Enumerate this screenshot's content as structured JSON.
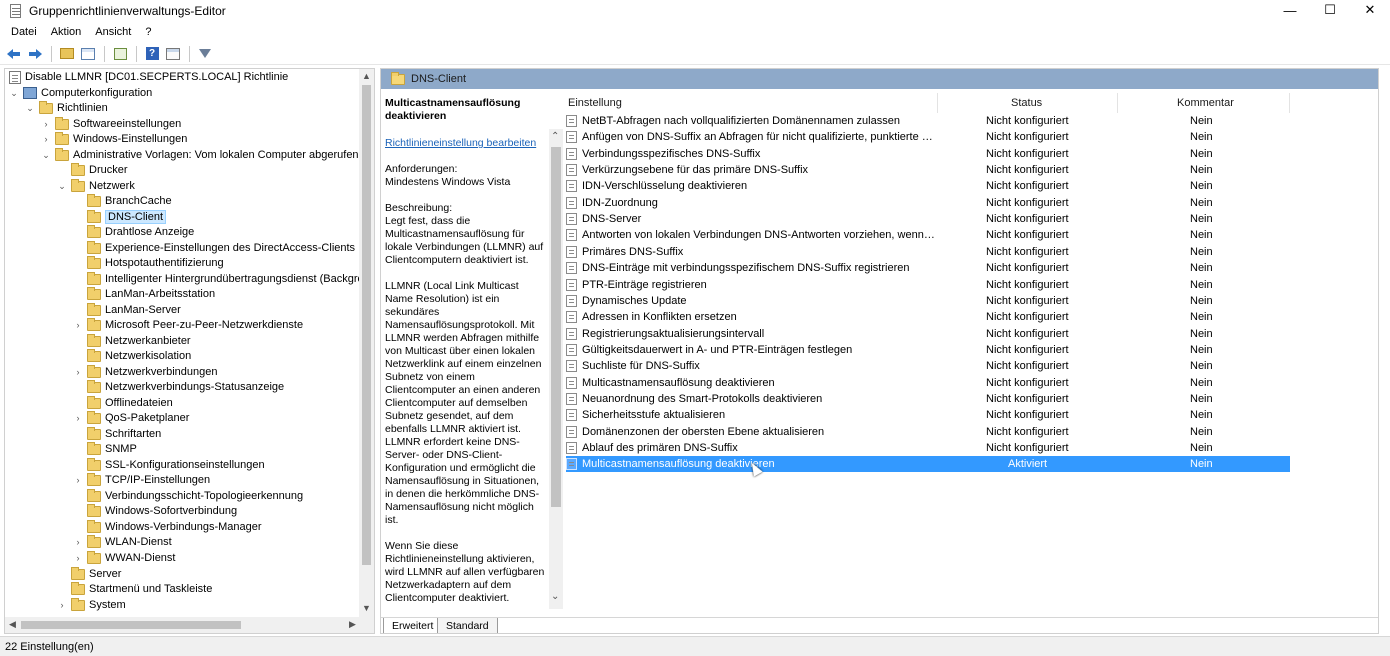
{
  "window": {
    "title": "Gruppenrichtlinienverwaltungs-Editor",
    "minimize": "—",
    "maximize": "☐",
    "close": "✕"
  },
  "menu": [
    "Datei",
    "Aktion",
    "Ansicht",
    "?"
  ],
  "tree": {
    "root": "Disable LLMNR [DC01.SECPERTS.LOCAL] Richtlinie",
    "computer": "Computerkonfiguration",
    "policies": "Richtlinien",
    "software": "Softwareeinstellungen",
    "windows": "Windows-Einstellungen",
    "admin_templates": "Administrative Vorlagen: Vom lokalen Computer abgerufene Ri",
    "printers": "Drucker",
    "network": "Netzwerk",
    "network_children": [
      {
        "label": "BranchCache",
        "expandable": false
      },
      {
        "label": "DNS-Client",
        "expandable": false,
        "selected": true
      },
      {
        "label": "Drahtlose Anzeige",
        "expandable": false
      },
      {
        "label": "Experience-Einstellungen des DirectAccess-Clients",
        "expandable": false
      },
      {
        "label": "Hotspotauthentifizierung",
        "expandable": false
      },
      {
        "label": "Intelligenter Hintergrundübertragungsdienst (Backgrour",
        "expandable": false
      },
      {
        "label": "LanMan-Arbeitsstation",
        "expandable": false
      },
      {
        "label": "LanMan-Server",
        "expandable": false
      },
      {
        "label": "Microsoft Peer-zu-Peer-Netzwerkdienste",
        "expandable": true
      },
      {
        "label": "Netzwerkanbieter",
        "expandable": false
      },
      {
        "label": "Netzwerkisolation",
        "expandable": false
      },
      {
        "label": "Netzwerkverbindungen",
        "expandable": true
      },
      {
        "label": "Netzwerkverbindungs-Statusanzeige",
        "expandable": false
      },
      {
        "label": "Offlinedateien",
        "expandable": false
      },
      {
        "label": "QoS-Paketplaner",
        "expandable": true
      },
      {
        "label": "Schriftarten",
        "expandable": false
      },
      {
        "label": "SNMP",
        "expandable": false
      },
      {
        "label": "SSL-Konfigurationseinstellungen",
        "expandable": false
      },
      {
        "label": "TCP/IP-Einstellungen",
        "expandable": true
      },
      {
        "label": "Verbindungsschicht-Topologieerkennung",
        "expandable": false
      },
      {
        "label": "Windows-Sofortverbindung",
        "expandable": false
      },
      {
        "label": "Windows-Verbindungs-Manager",
        "expandable": false
      },
      {
        "label": "WLAN-Dienst",
        "expandable": true
      },
      {
        "label": "WWAN-Dienst",
        "expandable": true
      }
    ],
    "server": "Server",
    "startmenu": "Startmenü und Taskleiste",
    "system": "System"
  },
  "right": {
    "header": "DNS-Client",
    "description": {
      "title": "Multicastnamensauflösung deaktivieren",
      "link": "Richtlinieneinstellung bearbeiten",
      "requirements": "Anforderungen:\nMindestens Windows Vista",
      "desc": "Beschreibung:\nLegt fest, dass die Multicastnamensauflösung für lokale Verbindungen (LLMNR) auf Clientcomputern deaktiviert ist.",
      "llmnr": "LLMNR (Local Link Multicast Name Resolution) ist ein sekundäres Namensauflösungsprotokoll. Mit LLMNR werden Abfragen mithilfe von Multicast über einen lokalen Netzwerklink auf einem einzelnen Subnetz von einem Clientcomputer  an einen anderen Clientcomputer auf demselben Subnetz gesendet, auf dem ebenfalls LLMNR aktiviert ist. LLMNR erfordert keine DNS-Server- oder DNS-Client-Konfiguration und ermöglicht die Namensauflösung in Situationen, in denen die herkömmliche DNS-Namensauflösung nicht möglich ist.",
      "enable": "Wenn Sie diese Richtlinieneinstellung aktivieren, wird LLMNR auf allen verfügbaren Netzwerkadaptern auf dem Clientcomputer deaktiviert."
    },
    "columns": {
      "name": "Einstellung",
      "status": "Status",
      "comment": "Kommentar"
    },
    "rows": [
      {
        "name": "NetBT-Abfragen nach vollqualifizierten Domänennamen zulassen",
        "status": "Nicht konfiguriert",
        "comment": "Nein"
      },
      {
        "name": "Anfügen von DNS-Suffix an Abfragen für nicht qualifizierte, punktierte Nam...",
        "status": "Nicht konfiguriert",
        "comment": "Nein"
      },
      {
        "name": "Verbindungsspezifisches DNS-Suffix",
        "status": "Nicht konfiguriert",
        "comment": "Nein"
      },
      {
        "name": "Verkürzungsebene für das primäre DNS-Suffix",
        "status": "Nicht konfiguriert",
        "comment": "Nein"
      },
      {
        "name": "IDN-Verschlüsselung deaktivieren",
        "status": "Nicht konfiguriert",
        "comment": "Nein"
      },
      {
        "name": "IDN-Zuordnung",
        "status": "Nicht konfiguriert",
        "comment": "Nein"
      },
      {
        "name": "DNS-Server",
        "status": "Nicht konfiguriert",
        "comment": "Nein"
      },
      {
        "name": "Antworten von lokalen Verbindungen DNS-Antworten vorziehen, wenn Sie ü...",
        "status": "Nicht konfiguriert",
        "comment": "Nein"
      },
      {
        "name": "Primäres DNS-Suffix",
        "status": "Nicht konfiguriert",
        "comment": "Nein"
      },
      {
        "name": "DNS-Einträge mit verbindungsspezifischem DNS-Suffix registrieren",
        "status": "Nicht konfiguriert",
        "comment": "Nein"
      },
      {
        "name": "PTR-Einträge registrieren",
        "status": "Nicht konfiguriert",
        "comment": "Nein"
      },
      {
        "name": "Dynamisches Update",
        "status": "Nicht konfiguriert",
        "comment": "Nein"
      },
      {
        "name": "Adressen in Konflikten ersetzen",
        "status": "Nicht konfiguriert",
        "comment": "Nein"
      },
      {
        "name": "Registrierungsaktualisierungsintervall",
        "status": "Nicht konfiguriert",
        "comment": "Nein"
      },
      {
        "name": "Gültigkeitsdauerwert in A- und PTR-Einträgen festlegen",
        "status": "Nicht konfiguriert",
        "comment": "Nein"
      },
      {
        "name": "Suchliste für DNS-Suffix",
        "status": "Nicht konfiguriert",
        "comment": "Nein"
      },
      {
        "name": "Multicastnamensauflösung deaktivieren",
        "status": "Nicht konfiguriert",
        "comment": "Nein"
      },
      {
        "name": "Neuanordnung des Smart-Protokolls deaktivieren",
        "status": "Nicht konfiguriert",
        "comment": "Nein"
      },
      {
        "name": "Sicherheitsstufe aktualisieren",
        "status": "Nicht konfiguriert",
        "comment": "Nein"
      },
      {
        "name": "Domänenzonen der obersten Ebene aktualisieren",
        "status": "Nicht konfiguriert",
        "comment": "Nein"
      },
      {
        "name": "Ablauf des primären DNS-Suffix",
        "status": "Nicht konfiguriert",
        "comment": "Nein"
      },
      {
        "name": "Multicastnamensauflösung deaktivieren",
        "status": "Aktiviert",
        "comment": "Nein",
        "selected": true
      }
    ],
    "tabs": [
      "Erweitert",
      "Standard"
    ]
  },
  "statusbar": "22 Einstellung(en)"
}
